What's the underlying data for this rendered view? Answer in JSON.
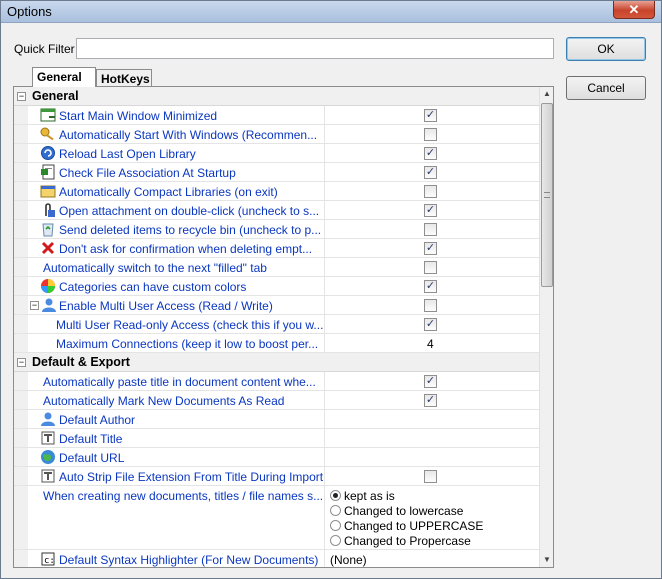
{
  "window": {
    "title": "Options",
    "close_symbol": "✕"
  },
  "quick_filter": {
    "label": "Quick Filter",
    "value": ""
  },
  "buttons": {
    "ok": "OK",
    "cancel": "Cancel"
  },
  "tabs": [
    {
      "label": "General",
      "active": true
    },
    {
      "label": "HotKeys",
      "active": false
    }
  ],
  "sections": {
    "general": "General",
    "default_export": "Default & Export"
  },
  "rows": [
    {
      "label": "Start Main Window Minimized",
      "icon": "window-icon",
      "checked": true
    },
    {
      "label": "Automatically Start With Windows (Recommen...",
      "icon": "key-icon",
      "checked": false
    },
    {
      "label": "Reload Last Open Library",
      "icon": "reload-icon",
      "checked": true
    },
    {
      "label": "Check File Association At Startup",
      "icon": "file-association-icon",
      "checked": true
    },
    {
      "label": "Automatically Compact Libraries (on exit)",
      "icon": "compact-icon",
      "checked": false
    },
    {
      "label": "Open attachment on double-click (uncheck to s...",
      "icon": "attachment-icon",
      "checked": true
    },
    {
      "label": "Send deleted items to recycle bin (uncheck to p...",
      "icon": "recycle-icon",
      "checked": false
    },
    {
      "label": "Don't ask for confirmation when deleting empt...",
      "icon": "delete-icon",
      "checked": true
    },
    {
      "label": "Automatically switch to the next \"filled\" tab",
      "icon": "",
      "checked": false
    },
    {
      "label": "Categories can have custom colors",
      "icon": "color-wheel-icon",
      "checked": true
    },
    {
      "label": "Enable Multi User Access (Read / Write)",
      "icon": "user-icon",
      "checked": false
    },
    {
      "label": "Multi User Read-only Access (check this if you w...",
      "icon": "",
      "checked": true
    },
    {
      "label": "Maximum Connections (keep it low to boost per...",
      "icon": "",
      "value": "4"
    }
  ],
  "export_rows": [
    {
      "label": "Automatically paste title in document content whe...",
      "icon": "",
      "checked": true
    },
    {
      "label": "Automatically Mark New Documents As Read",
      "icon": "",
      "checked": true
    },
    {
      "label": "Default Author",
      "icon": "author-icon"
    },
    {
      "label": "Default Title",
      "icon": "title-icon"
    },
    {
      "label": "Default URL",
      "icon": "globe-icon"
    },
    {
      "label": "Auto Strip File Extension From Title During Import",
      "icon": "strip-icon",
      "checked": false
    },
    {
      "label": "When creating new documents, titles / file names s...",
      "icon": ""
    },
    {
      "label": "Default Syntax Highlighter (For New Documents)",
      "icon": "syntax-icon",
      "value": "(None)"
    }
  ],
  "title_case_options": [
    {
      "label": "kept as is",
      "selected": true
    },
    {
      "label": "Changed to lowercase",
      "selected": false
    },
    {
      "label": "Changed to UPPERCASE",
      "selected": false
    },
    {
      "label": "Changed to Propercase",
      "selected": false
    }
  ]
}
